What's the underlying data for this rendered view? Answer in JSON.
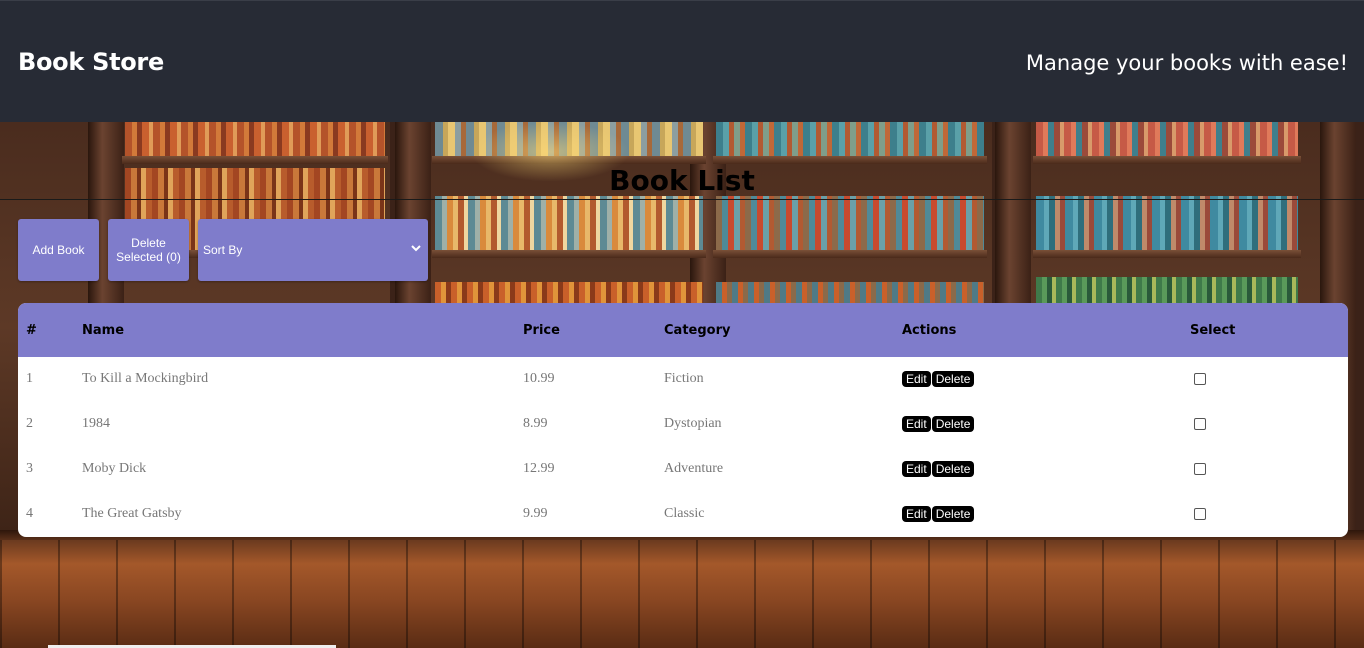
{
  "header": {
    "brand": "Book Store",
    "tagline": "Manage your books with ease!"
  },
  "page": {
    "title": "Book List"
  },
  "toolbar": {
    "add_label": "Add Book",
    "delete_label": "Delete Selected (0)",
    "sort_label": "Sort By"
  },
  "table": {
    "columns": [
      "#",
      "Name",
      "Price",
      "Category",
      "Actions",
      "Select"
    ],
    "rows": [
      {
        "num": "1",
        "name": "To Kill a Mockingbird",
        "price": "10.99",
        "category": "Fiction",
        "selected": false
      },
      {
        "num": "2",
        "name": "1984",
        "price": "8.99",
        "category": "Dystopian",
        "selected": false
      },
      {
        "num": "3",
        "name": "Moby Dick",
        "price": "12.99",
        "category": "Adventure",
        "selected": false
      },
      {
        "num": "4",
        "name": "The Great Gatsby",
        "price": "9.99",
        "category": "Classic",
        "selected": false
      }
    ],
    "action_edit": "Edit",
    "action_delete": "Delete"
  },
  "colors": {
    "header_bg": "#272b35",
    "accent": "#7f7ccb",
    "action_btn": "#000000"
  },
  "icons": {
    "sort": "chevron-down-icon"
  }
}
